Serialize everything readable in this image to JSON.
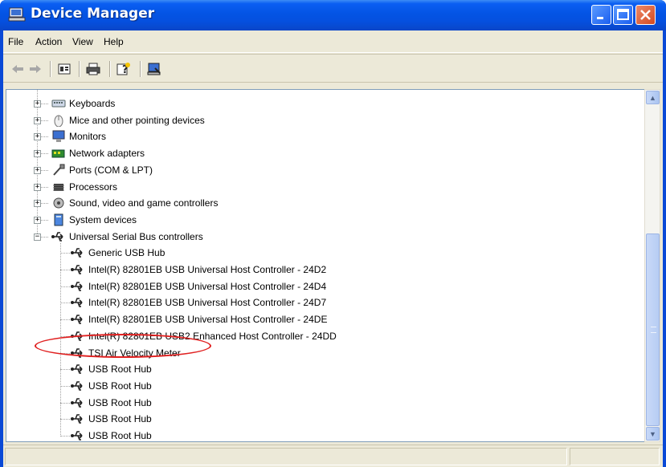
{
  "window": {
    "title": "Device Manager",
    "title_icon": "computer-icon"
  },
  "menu": [
    {
      "label": "File"
    },
    {
      "label": "Action"
    },
    {
      "label": "View"
    },
    {
      "label": "Help"
    }
  ],
  "toolbar": {
    "icons": [
      "back-arrow-icon",
      "forward-arrow-icon",
      "properties-icon",
      "print-icon",
      "help-icon",
      "scan-hardware-icon"
    ]
  },
  "tree": {
    "categories": [
      {
        "label": "Keyboards",
        "icon": "keyboard-icon",
        "expanded": false
      },
      {
        "label": "Mice and other pointing devices",
        "icon": "mouse-icon",
        "expanded": false
      },
      {
        "label": "Monitors",
        "icon": "monitor-icon",
        "expanded": false
      },
      {
        "label": "Network adapters",
        "icon": "network-adapter-icon",
        "expanded": false
      },
      {
        "label": "Ports (COM & LPT)",
        "icon": "port-icon",
        "expanded": false
      },
      {
        "label": "Processors",
        "icon": "processor-icon",
        "expanded": false
      },
      {
        "label": "Sound, video and game controllers",
        "icon": "sound-icon",
        "expanded": false
      },
      {
        "label": "System devices",
        "icon": "system-device-icon",
        "expanded": false
      },
      {
        "label": "Universal Serial Bus controllers",
        "icon": "usb-icon",
        "expanded": true
      }
    ],
    "usb_children": [
      {
        "label": "Generic USB Hub"
      },
      {
        "label": "Intel(R) 82801EB USB Universal Host Controller - 24D2"
      },
      {
        "label": "Intel(R) 82801EB USB Universal Host Controller - 24D4"
      },
      {
        "label": "Intel(R) 82801EB USB Universal Host Controller - 24D7"
      },
      {
        "label": "Intel(R) 82801EB USB Universal Host Controller - 24DE"
      },
      {
        "label": "Intel(R) 82801EB USB2 Enhanced Host Controller - 24DD"
      },
      {
        "label": "TSI Air Velocity Meter"
      },
      {
        "label": "USB Root Hub"
      },
      {
        "label": "USB Root Hub"
      },
      {
        "label": "USB Root Hub"
      },
      {
        "label": "USB Root Hub"
      },
      {
        "label": "USB Root Hub"
      }
    ]
  },
  "colors": {
    "title_bar": "#0454e4",
    "highlight_ellipse": "#e02020",
    "window_bg": "#ece9d8"
  }
}
